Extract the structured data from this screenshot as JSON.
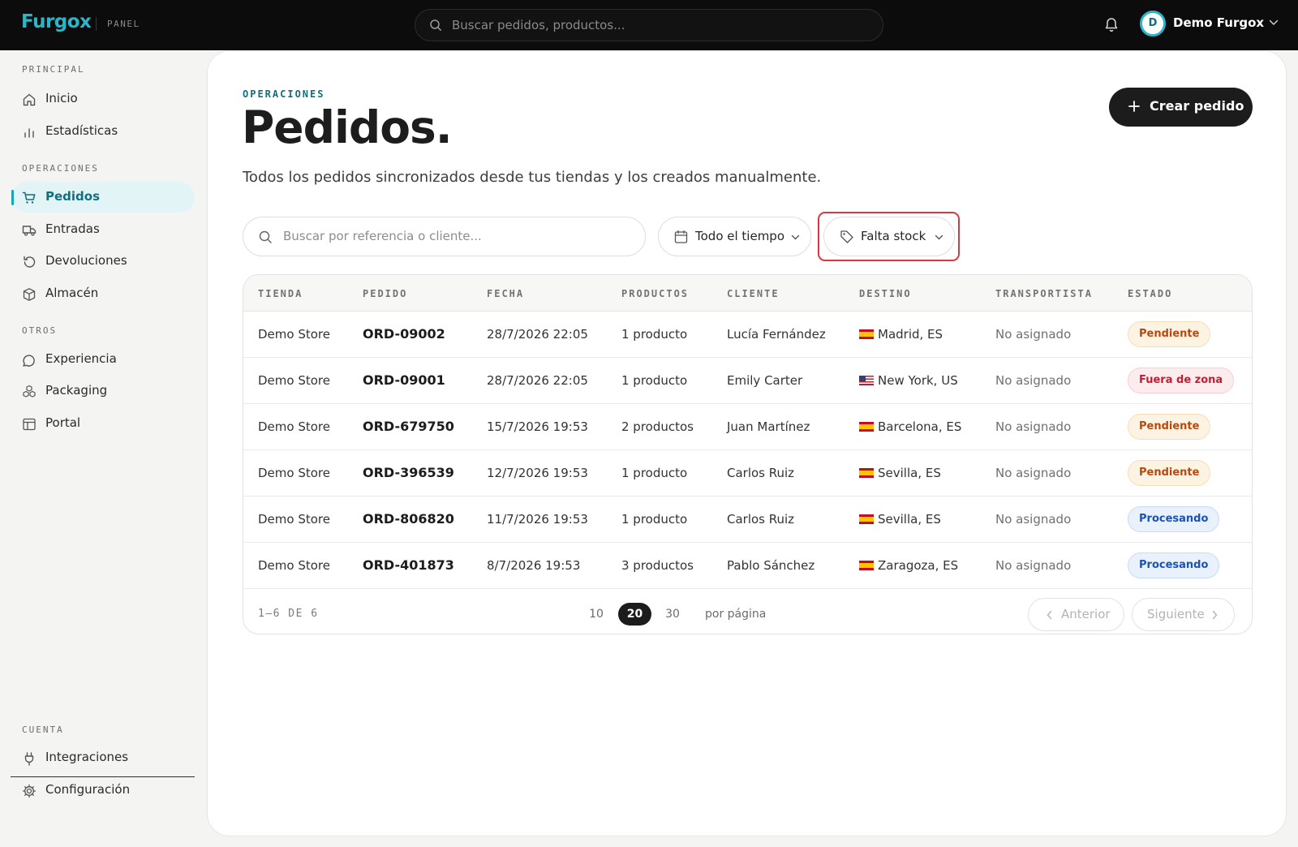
{
  "topbar": {
    "logo": "Furgox",
    "logo_sub": "PANEL",
    "search_placeholder": "Buscar pedidos, productos...",
    "user": {
      "initial": "D",
      "name": "Demo Furgox"
    }
  },
  "sidebar": {
    "sections": {
      "principal": "PRINCIPAL",
      "operaciones": "OPERACIONES",
      "otros": "OTROS",
      "cuenta": "CUENTA"
    },
    "items": [
      {
        "label": "Inicio",
        "icon": "home-icon"
      },
      {
        "label": "Estadísticas",
        "icon": "bar-chart-icon"
      },
      {
        "label": "Pedidos",
        "icon": "cart-icon",
        "active": true
      },
      {
        "label": "Entradas",
        "icon": "truck-icon"
      },
      {
        "label": "Devoluciones",
        "icon": "undo-icon"
      },
      {
        "label": "Almacén",
        "icon": "box-icon"
      },
      {
        "label": "Experiencia",
        "icon": "chat-icon"
      },
      {
        "label": "Packaging",
        "icon": "boxes-icon"
      },
      {
        "label": "Portal",
        "icon": "layout-icon"
      },
      {
        "label": "Integraciones",
        "icon": "plug-icon"
      },
      {
        "label": "Configuración",
        "icon": "gear-icon"
      }
    ]
  },
  "main": {
    "eyebrow": "OPERACIONES",
    "title": "Pedidos.",
    "subtitle": "Todos los pedidos sincronizados desde tus tiendas y los creados manualmente.",
    "create_button": "Crear pedido",
    "search_placeholder": "Buscar por referencia o cliente...",
    "filters": {
      "date": "Todo el tiempo",
      "tag": "Falta stock"
    }
  },
  "table": {
    "columns": [
      "TIENDA",
      "PEDIDO",
      "FECHA",
      "PRODUCTOS",
      "CLIENTE",
      "DESTINO",
      "TRANSPORTISTA",
      "ESTADO"
    ],
    "rows": [
      {
        "store": "Demo Store",
        "ref": "ORD-09002",
        "date": "28/7/2026 22:05",
        "products": "1 producto",
        "client": "Lucía Fernández",
        "flag": "es",
        "dest": "Madrid, ES",
        "carrier": "No asignado",
        "status": "Pendiente",
        "status_kind": "pend"
      },
      {
        "store": "Demo Store",
        "ref": "ORD-09001",
        "date": "28/7/2026 22:05",
        "products": "1 producto",
        "client": "Emily Carter",
        "flag": "us",
        "dest": "New York, US",
        "carrier": "No asignado",
        "status": "Fuera de zona",
        "status_kind": "zone"
      },
      {
        "store": "Demo Store",
        "ref": "ORD-679750",
        "date": "15/7/2026 19:53",
        "products": "2 productos",
        "client": "Juan Martínez",
        "flag": "es",
        "dest": "Barcelona, ES",
        "carrier": "No asignado",
        "status": "Pendiente",
        "status_kind": "pend"
      },
      {
        "store": "Demo Store",
        "ref": "ORD-396539",
        "date": "12/7/2026 19:53",
        "products": "1 producto",
        "client": "Carlos Ruiz",
        "flag": "es",
        "dest": "Sevilla, ES",
        "carrier": "No asignado",
        "status": "Pendiente",
        "status_kind": "pend"
      },
      {
        "store": "Demo Store",
        "ref": "ORD-806820",
        "date": "11/7/2026 19:53",
        "products": "1 producto",
        "client": "Carlos Ruiz",
        "flag": "es",
        "dest": "Sevilla, ES",
        "carrier": "No asignado",
        "status": "Procesando",
        "status_kind": "proc"
      },
      {
        "store": "Demo Store",
        "ref": "ORD-401873",
        "date": "8/7/2026 19:53",
        "products": "3 productos",
        "client": "Pablo Sánchez",
        "flag": "es",
        "dest": "Zaragoza, ES",
        "carrier": "No asignado",
        "status": "Procesando",
        "status_kind": "proc"
      }
    ],
    "footer": {
      "range": "1–6 DE 6",
      "page_sizes": [
        "10",
        "20",
        "30"
      ],
      "selected_page_size": "20",
      "per_page": "por página",
      "prev": "Anterior",
      "next": "Siguiente"
    }
  },
  "colors": {
    "brand": "#2cb5c8",
    "brand_dark": "#126f7d",
    "highlight": "#d43a45"
  }
}
